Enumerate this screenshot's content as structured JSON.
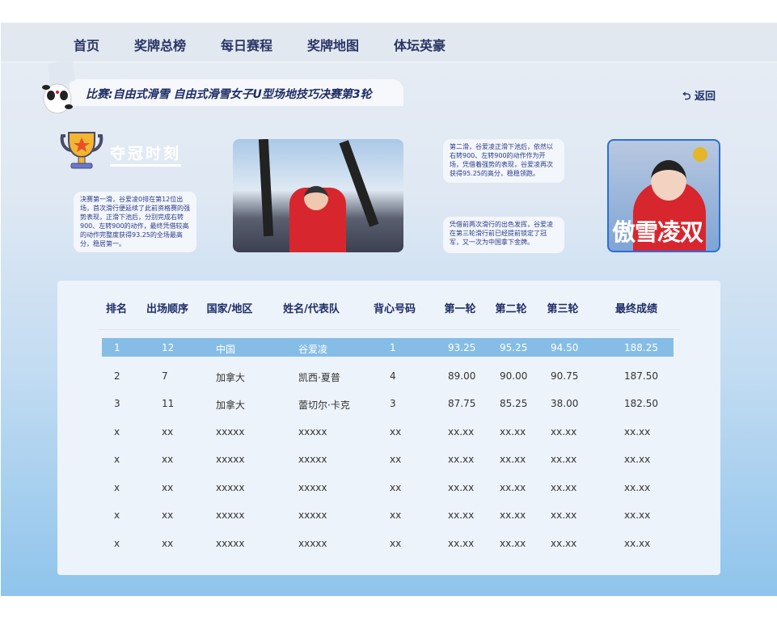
{
  "nav": [
    "首页",
    "奖牌总榜",
    "每日赛程",
    "奖牌地图",
    "体坛英豪"
  ],
  "title": "比赛:自由式滑雪 自由式滑雪女子U型场地技巧决赛第3轮",
  "back_label": "返回",
  "champion_heading": "夺冠时刻",
  "notes": [
    "决赛第一滑，谷爱凌0排在第12位出场，首次滑行便延续了此前资格赛的强势表现，正滑下池后，分别完成右转900、左转900的动作，最终凭借较高的动作完整度获得93.25的全场最高分，稳居第一。",
    "第二滑，谷爱凌正滑下池后，依然以右转900、左转900的动作作为开场，凭借着强势的表现，谷爱凌再次获得95.25的高分，稳稳领跑。",
    "凭借前两次滑行的出色发挥，谷爱凌在第三轮滑行前已经提前锁定了冠军，又一次为中国拿下金牌。"
  ],
  "poster_text": "傲雪凌双",
  "table": {
    "headers": [
      "排名",
      "出场顺序",
      "国家/地区",
      "姓名/代表队",
      "背心号码",
      "第一轮",
      "第二轮",
      "第三轮",
      "最终成绩"
    ],
    "rows": [
      [
        "1",
        "12",
        "中国",
        "谷爱凌",
        "1",
        "93.25",
        "95.25",
        "94.50",
        "188.25"
      ],
      [
        "2",
        "7",
        "加拿大",
        "凯西·夏普",
        "4",
        "89.00",
        "90.00",
        "90.75",
        "187.50"
      ],
      [
        "3",
        "11",
        "加拿大",
        "蕾切尔·卡克",
        "3",
        "87.75",
        "85.25",
        "38.00",
        "182.50"
      ],
      [
        "x",
        "xx",
        "xxxxx",
        "xxxxx",
        "xx",
        "xx.xx",
        "xx.xx",
        "xx.xx",
        "xx.xx"
      ],
      [
        "x",
        "xx",
        "xxxxx",
        "xxxxx",
        "xx",
        "xx.xx",
        "xx.xx",
        "xx.xx",
        "xx.xx"
      ],
      [
        "x",
        "xx",
        "xxxxx",
        "xxxxx",
        "xx",
        "xx.xx",
        "xx.xx",
        "xx.xx",
        "xx.xx"
      ],
      [
        "x",
        "xx",
        "xxxxx",
        "xxxxx",
        "xx",
        "xx.xx",
        "xx.xx",
        "xx.xx",
        "xx.xx"
      ],
      [
        "x",
        "xx",
        "xxxxx",
        "xxxxx",
        "xx",
        "xx.xx",
        "xx.xx",
        "xx.xx",
        "xx.xx"
      ]
    ],
    "highlight_color": "#86bde6"
  }
}
